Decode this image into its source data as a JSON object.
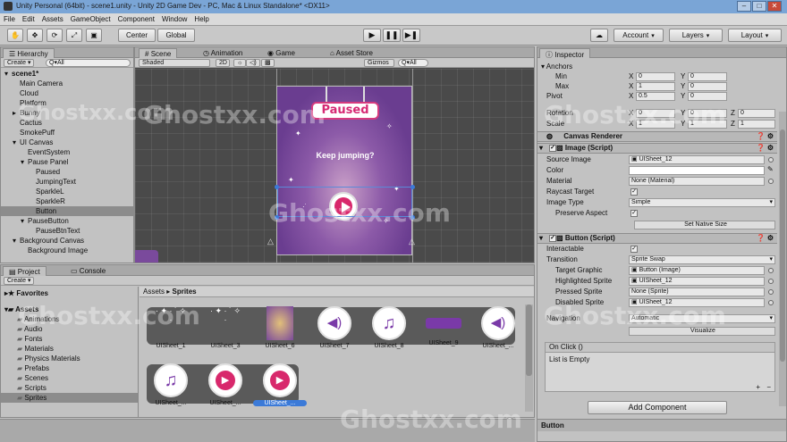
{
  "window": {
    "title": "Unity Personal (64bit) - scene1.unity - Unity 2D Game Dev - PC, Mac & Linux Standalone* <DX11>"
  },
  "menu": [
    "File",
    "Edit",
    "Assets",
    "GameObject",
    "Component",
    "Window",
    "Help"
  ],
  "toolbar": {
    "pivot": "Center",
    "space": "Global",
    "account": "Account",
    "layers": "Layers",
    "layout": "Layout"
  },
  "hierarchy": {
    "tab": "Hierarchy",
    "create": "Create",
    "search_all": "Q▾All",
    "items": [
      {
        "label": "scene1*",
        "indent": 0,
        "arrow": "▾"
      },
      {
        "label": "Main Camera",
        "indent": 1
      },
      {
        "label": "Cloud",
        "indent": 1
      },
      {
        "label": "Platform",
        "indent": 1
      },
      {
        "label": "Bunny",
        "indent": 1,
        "arrow": "▸"
      },
      {
        "label": "Cactus",
        "indent": 1
      },
      {
        "label": "SmokePuff",
        "indent": 1
      },
      {
        "label": "UI Canvas",
        "indent": 1,
        "arrow": "▾"
      },
      {
        "label": "EventSystem",
        "indent": 2
      },
      {
        "label": "Pause Panel",
        "indent": 2,
        "arrow": "▾"
      },
      {
        "label": "Paused",
        "indent": 3
      },
      {
        "label": "JumpingText",
        "indent": 3
      },
      {
        "label": "SparkleL",
        "indent": 3
      },
      {
        "label": "SparkleR",
        "indent": 3
      },
      {
        "label": "Button",
        "indent": 3,
        "selected": true
      },
      {
        "label": "PauseButton",
        "indent": 2,
        "arrow": "▾"
      },
      {
        "label": "PauseBtnText",
        "indent": 3
      },
      {
        "label": "Background Canvas",
        "indent": 1,
        "arrow": "▾"
      },
      {
        "label": "Background Image",
        "indent": 2
      }
    ]
  },
  "scene": {
    "tabs": [
      "Scene",
      "Animation",
      "Game",
      "Asset Store"
    ],
    "shading": "Shaded",
    "mode2d": "2D",
    "gizmos": "Gizmos",
    "search_all": "Q▾All",
    "paused_text": "Paused",
    "keep_jumping": "Keep jumping?"
  },
  "project": {
    "tabs": [
      "Project",
      "Console"
    ],
    "create": "Create",
    "favorites": "Favorites",
    "assets_root": "Assets",
    "folders": [
      "Animations",
      "Audio",
      "Fonts",
      "Materials",
      "Physics Materials",
      "Prefabs",
      "Scenes",
      "Scripts",
      "Sprites"
    ],
    "breadcrumb": [
      "Assets",
      "Sprites"
    ],
    "assets_row1": [
      "UISheet_1",
      "UISheet_3",
      "UISheet_6",
      "UISheet_7",
      "UISheet_8",
      "UISheet_9",
      "UISheet_..."
    ],
    "assets_row2": [
      "UISheet_...",
      "UISheet_...",
      "UISheet_..."
    ]
  },
  "inspector": {
    "tab": "Inspector",
    "anchors": {
      "label": "Anchors",
      "min_label": "Min",
      "max_label": "Max",
      "min_x": "0",
      "min_y": "0",
      "max_x": "1",
      "max_y": "0"
    },
    "pivot": {
      "label": "Pivot",
      "x": "0.5",
      "y": "0"
    },
    "rotation": {
      "label": "Rotation",
      "x": "0",
      "y": "0",
      "z": "0"
    },
    "scale": {
      "label": "Scale",
      "x": "1",
      "y": "1",
      "z": "1"
    },
    "canvas_renderer": "Canvas Renderer",
    "image": {
      "title": "Image (Script)",
      "source_label": "Source Image",
      "source": "UISheet_12",
      "color_label": "Color",
      "material_label": "Material",
      "material": "None (Material)",
      "raycast_label": "Raycast Target",
      "type_label": "Image Type",
      "type": "Simple",
      "aspect_label": "Preserve Aspect",
      "native": "Set Native Size"
    },
    "button": {
      "title": "Button (Script)",
      "interactable_label": "Interactable",
      "transition_label": "Transition",
      "transition": "Sprite Swap",
      "target_label": "Target Graphic",
      "target": "Button (Image)",
      "highlighted_label": "Highlighted Sprite",
      "highlighted": "UISheet_12",
      "pressed_label": "Pressed Sprite",
      "pressed": "None (Sprite)",
      "disabled_label": "Disabled Sprite",
      "disabled": "UISheet_12",
      "navigation_label": "Navigation",
      "navigation": "Automatic",
      "visualize": "Visualize",
      "onclick": "On Click ()",
      "list_empty": "List is Empty"
    },
    "add_component": "Add Component",
    "footer": "Button"
  },
  "watermark": "Ghostxx.com",
  "colors": {
    "accent_pink": "#d8286c",
    "panel_purple": "#7a4a9c",
    "selection": "#8c8c8c"
  }
}
